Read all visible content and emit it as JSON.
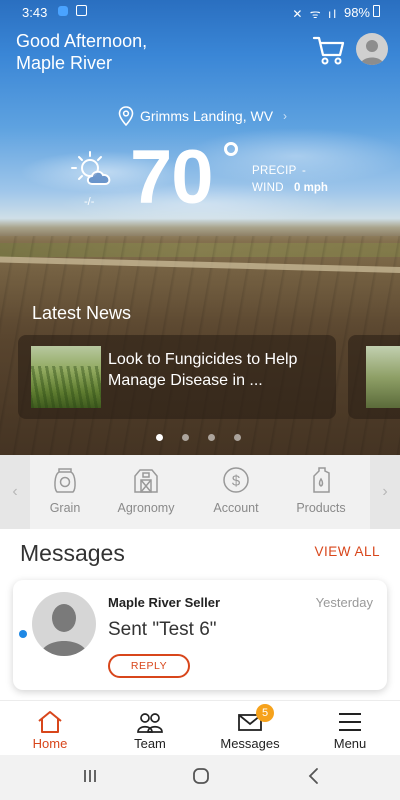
{
  "status_bar": {
    "time": "3:43",
    "icons": "✕ ᯤ ıl",
    "battery": "98%"
  },
  "header": {
    "greeting_line1": "Good Afternoon,",
    "greeting_line2": "Maple River",
    "cart_icon": "cart-icon",
    "avatar_icon": "avatar-icon"
  },
  "weather": {
    "location": "Grimms Landing, WV",
    "location_chevron": "›",
    "condition_icon": "partly-cloudy-icon",
    "sub": "-/-",
    "temperature": "70",
    "precip_label": "PRECIP",
    "precip_value": "-",
    "wind_label": "WIND",
    "wind_value": "0 mph"
  },
  "news": {
    "heading": "Latest News",
    "items": [
      {
        "title": "Look to Fungicides to Help Manage Disease in ..."
      }
    ],
    "dots_total": 4,
    "active_dot": 0
  },
  "categories": {
    "left_arrow": "‹",
    "right_arrow": "›",
    "items": [
      {
        "label": "Grain",
        "icon": "grain-bag-icon"
      },
      {
        "label": "Agronomy",
        "icon": "barn-icon"
      },
      {
        "label": "Account",
        "icon": "dollar-icon"
      },
      {
        "label": "Products",
        "icon": "jug-icon"
      }
    ]
  },
  "messages": {
    "title": "Messages",
    "view_all": "VIEW ALL",
    "items": [
      {
        "sender": "Maple River Seller",
        "date": "Yesterday",
        "text": "Sent \"Test 6\"",
        "reply": "REPLY",
        "unread": true
      }
    ]
  },
  "bottom_nav": {
    "items": [
      {
        "label": "Home",
        "icon": "home-icon",
        "active": true
      },
      {
        "label": "Team",
        "icon": "team-icon"
      },
      {
        "label": "Messages",
        "icon": "envelope-icon",
        "badge": "5"
      },
      {
        "label": "Menu",
        "icon": "hamburger-icon"
      }
    ]
  },
  "android_nav": {
    "recents": "|||",
    "home": "○",
    "back": "‹"
  },
  "colors": {
    "accent": "#d8461b",
    "badge": "#f6a21b",
    "unread": "#1e88e5"
  }
}
